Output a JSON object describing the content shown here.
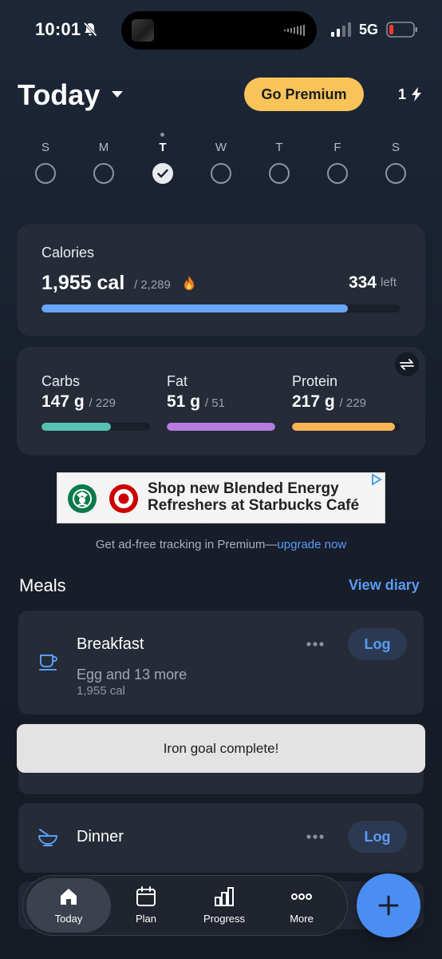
{
  "status_bar": {
    "time": "10:01",
    "network": "5G"
  },
  "header": {
    "title": "Today",
    "premium_label": "Go Premium",
    "streak_count": "1"
  },
  "week": {
    "days": [
      {
        "letter": "S",
        "state": "empty"
      },
      {
        "letter": "M",
        "state": "empty"
      },
      {
        "letter": "T",
        "state": "done"
      },
      {
        "letter": "W",
        "state": "empty"
      },
      {
        "letter": "T",
        "state": "empty"
      },
      {
        "letter": "F",
        "state": "empty"
      },
      {
        "letter": "S",
        "state": "empty"
      }
    ],
    "selected_index": 2
  },
  "calories": {
    "label": "Calories",
    "value": "1,955 cal",
    "goal": "/ 2,289",
    "left_value": "334",
    "left_label": "left",
    "progress": 0.854,
    "color": "#6aa6f8"
  },
  "macros": [
    {
      "name": "Carbs",
      "value": "147 g",
      "goal": "/ 229",
      "progress": 0.642,
      "color": "#56c2b6"
    },
    {
      "name": "Fat",
      "value": "51 g",
      "goal": "/ 51",
      "progress": 1.0,
      "color": "#b57be0"
    },
    {
      "name": "Protein",
      "value": "217 g",
      "goal": "/ 229",
      "progress": 0.948,
      "color": "#f6b552"
    }
  ],
  "ad": {
    "text_line1": "Shop new Blended Energy",
    "text_line2": "Refreshers at Starbucks Café",
    "note_prefix": "Get ad-free tracking in Premium—",
    "note_link": "upgrade now"
  },
  "meals": {
    "title": "Meals",
    "view_diary_label": "View diary",
    "items": [
      {
        "name": "Breakfast",
        "description": "Egg and 13 more",
        "calories": "1,955 cal",
        "log_label": "Log",
        "icon": "coffee-cup-icon"
      },
      {
        "name": "Dinner",
        "description": "",
        "calories": "",
        "log_label": "Log",
        "icon": "bowl-icon"
      }
    ]
  },
  "toast": {
    "message": "Iron goal complete!"
  },
  "tabbar": {
    "tabs": [
      {
        "label": "Today",
        "icon": "home-icon",
        "active": true
      },
      {
        "label": "Plan",
        "icon": "calendar-icon",
        "active": false
      },
      {
        "label": "Progress",
        "icon": "bar-chart-icon",
        "active": false
      },
      {
        "label": "More",
        "icon": "more-dots-icon",
        "active": false
      }
    ],
    "fab_icon": "plus-icon"
  }
}
